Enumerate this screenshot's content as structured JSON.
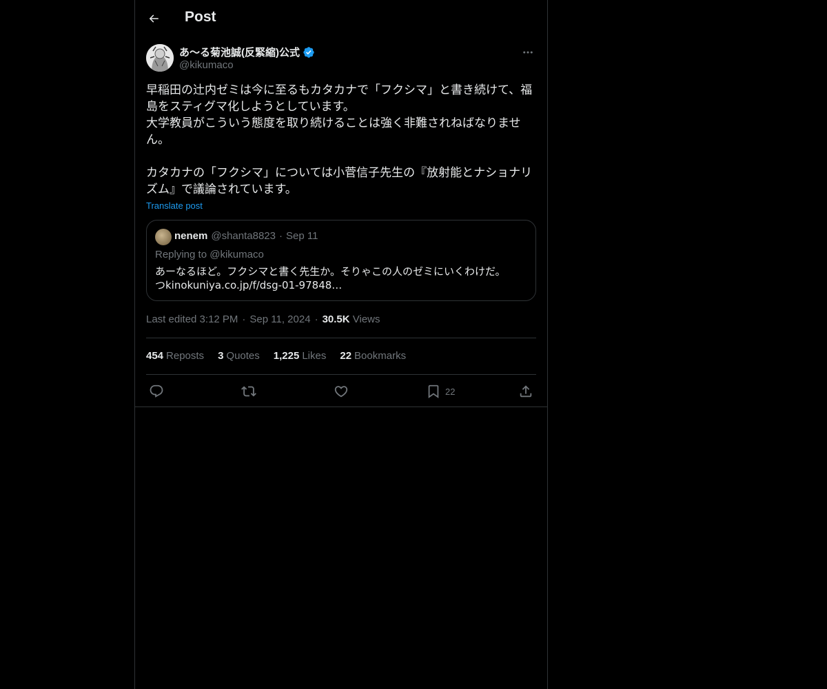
{
  "header": {
    "title": "Post"
  },
  "author": {
    "name": "あ〜る菊池誠(反緊縮)公式",
    "handle": "@kikumaco"
  },
  "post": {
    "text": "早稲田の辻内ゼミは今に至るもカタカナで「フクシマ」と書き続けて、福\n島をスティグマ化しようとしています。\n大学教員がこういう態度を取り続けることは強く非難されねばなりませ\nん。\n\nカタカナの「フクシマ」については小菅信子先生の『放射能とナショナリ\nズム』で議論されています。",
    "translate_label": "Translate post"
  },
  "quote": {
    "name": "nenem",
    "handle": "@shanta8823",
    "dot": "·",
    "date": "Sep 11",
    "replying": "Replying to @kikumaco",
    "text": "あーなるほど。フクシマと書く先生か。そりゃこの人のゼミにいくわけだ。\nつkinokuniya.co.jp/f/dsg-01-97848…"
  },
  "meta": {
    "edited": "Last edited 3:12 PM",
    "dot": "·",
    "date": "Sep 11, 2024",
    "views_count": "30.5K",
    "views_label": "Views"
  },
  "stats": [
    {
      "num": "454",
      "label": "Reposts"
    },
    {
      "num": "3",
      "label": "Quotes"
    },
    {
      "num": "1,225",
      "label": "Likes"
    },
    {
      "num": "22",
      "label": "Bookmarks"
    }
  ],
  "actions": {
    "bookmark_count": "22"
  },
  "colors": {
    "background": "#000000",
    "text": "#e7e9ea",
    "muted": "#71767b",
    "accent": "#1d9bf0",
    "border": "#2f3336"
  }
}
